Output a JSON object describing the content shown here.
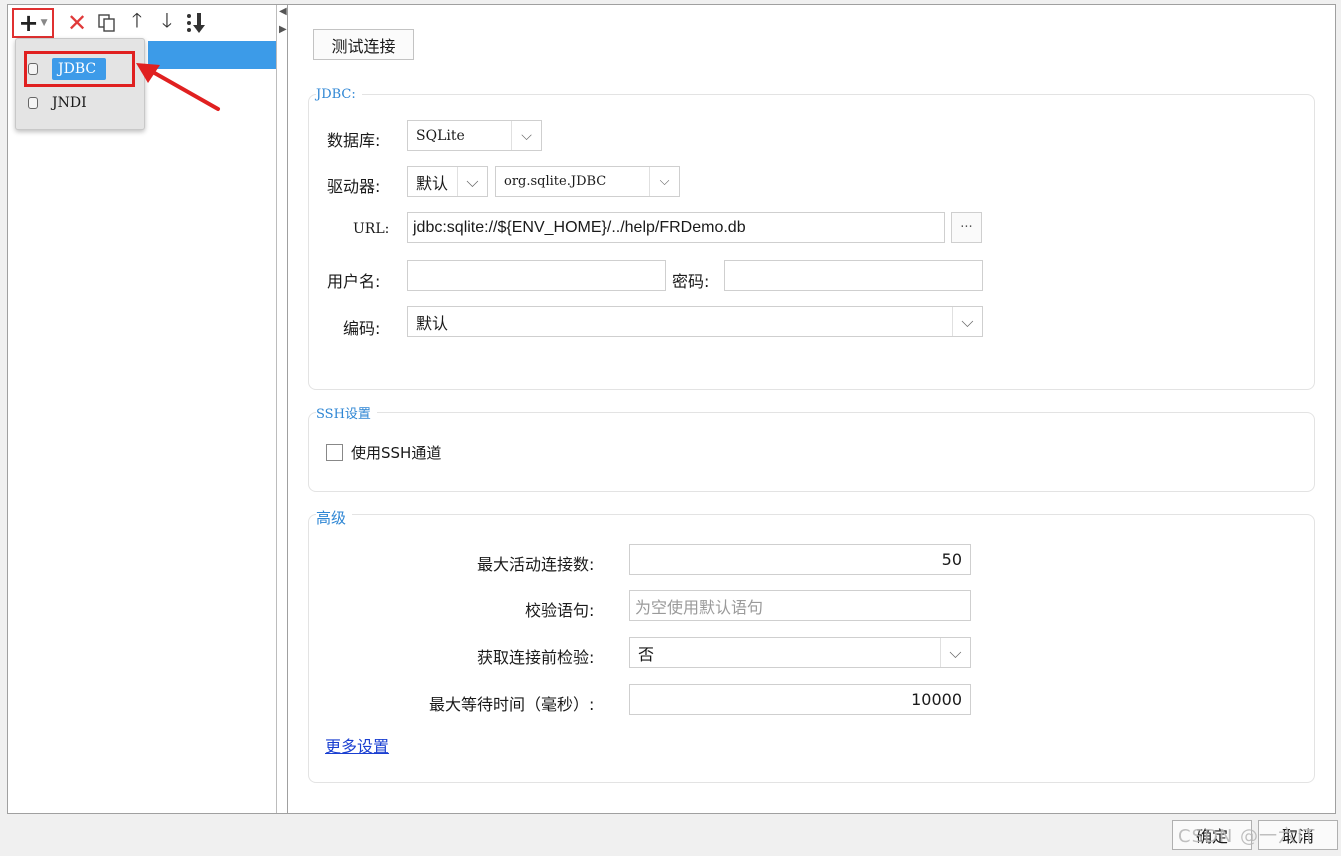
{
  "toolbar": {
    "add_icon": "plus-icon",
    "delete_icon": "close-icon",
    "copy_icon": "copy-icon",
    "up_icon": "arrow-up-icon",
    "down_icon": "arrow-down-icon",
    "sort_icon": "sort-icon"
  },
  "dropdown": {
    "items": [
      {
        "label": "JDBC",
        "selected": true
      },
      {
        "label": "JNDI",
        "selected": false
      }
    ]
  },
  "main": {
    "test_button": "测试连接",
    "jdbc_group": {
      "title": "JDBC:",
      "database_label": "数据库:",
      "database_value": "SQLite",
      "driver_label": "驱动器:",
      "driver_mode": "默认",
      "driver_class": "org.sqlite.JDBC",
      "url_label": "URL:",
      "url_value": "jdbc:sqlite://${ENV_HOME}/../help/FRDemo.db",
      "url_browse": "···",
      "username_label": "用户名:",
      "username_value": "",
      "password_label": "密码:",
      "password_value": "",
      "encoding_label": "编码:",
      "encoding_value": "默认"
    },
    "ssh_group": {
      "title": "SSH设置",
      "use_ssh_label": "使用SSH通道"
    },
    "advanced_group": {
      "title": "高级",
      "max_active_label": "最大活动连接数:",
      "max_active_value": "50",
      "validation_query_label": "校验语句:",
      "validation_query_placeholder": "为空使用默认语句",
      "test_on_borrow_label": "获取连接前检验:",
      "test_on_borrow_value": "否",
      "max_wait_label": "最大等待时间（毫秒）:",
      "max_wait_value": "10000",
      "more_settings_link": "更多设置"
    }
  },
  "footer": {
    "ok_button": "确定",
    "cancel_button": "取消",
    "watermark": "CSDN @一六IT"
  },
  "colors": {
    "accent": "#2e86d4",
    "selection": "#3c9be8",
    "highlight_red": "#e02020"
  }
}
